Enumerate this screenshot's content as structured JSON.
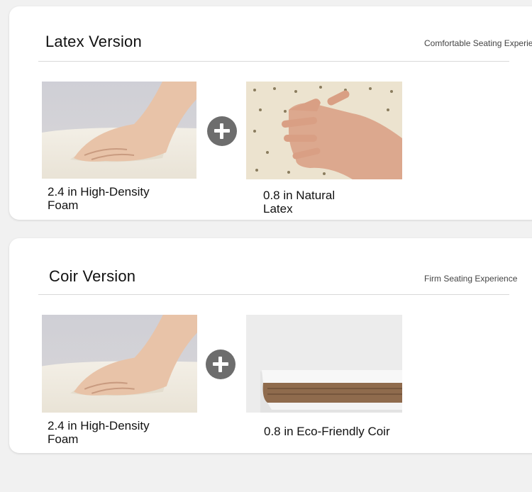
{
  "latex": {
    "title": "Latex Version",
    "subtitle": "Comfortable Seating Experience",
    "left_caption": "2.4 in High-Density Foam",
    "right_caption": "0.8 in Natural Latex",
    "icon_plus": "plus-circle-icon"
  },
  "coir": {
    "title": "Coir Version",
    "subtitle": "Firm Seating Experience",
    "left_caption": "2.4 in High-Density Foam",
    "right_caption": "0.8 in Eco-Friendly Coir",
    "icon_plus": "plus-circle-icon"
  },
  "colors": {
    "background": "#f1f1f1",
    "card": "#ffffff",
    "plus_icon": "#6d6d6d",
    "divider": "#d9d9d9"
  }
}
